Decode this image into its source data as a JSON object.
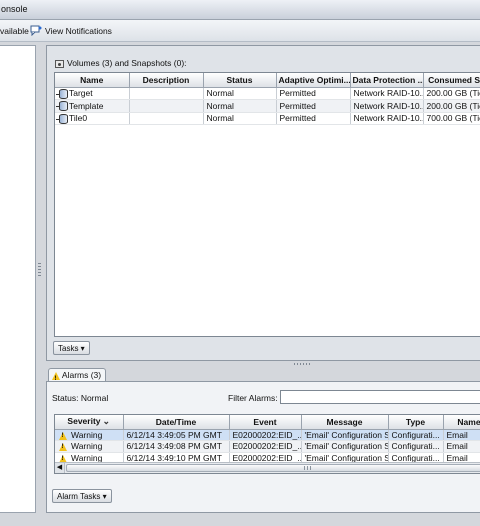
{
  "window": {
    "title": "onsole"
  },
  "toolbar": {
    "available_label": "vailable",
    "view_notifications_label": "View Notifications"
  },
  "volumes": {
    "header": "Volumes (3) and Snapshots (0):",
    "columns": [
      "Name",
      "Description",
      "Status",
      "Adaptive Optimi...",
      "Data Protection ...",
      "Consumed Spa"
    ],
    "rows": [
      {
        "name": "Target",
        "description": "",
        "status": "Normal",
        "adaptive": "Permitted",
        "protection": "Network RAID-10...",
        "consumed": "200.00 GB (Tier"
      },
      {
        "name": "Template",
        "description": "",
        "status": "Normal",
        "adaptive": "Permitted",
        "protection": "Network RAID-10...",
        "consumed": "200.00 GB (Tier"
      },
      {
        "name": "Tile0",
        "description": "",
        "status": "Normal",
        "adaptive": "Permitted",
        "protection": "Network RAID-10...",
        "consumed": "700.00 GB (Tier"
      }
    ],
    "tasks_button": "Tasks ▾"
  },
  "alarms": {
    "tab_label": "Alarms (3)",
    "status_label": "Status:  Normal",
    "filter_label": "Filter Alarms:",
    "filter_value": "",
    "columns": [
      "Severity",
      "Date/Time",
      "Event",
      "Message",
      "Type",
      "Name"
    ],
    "rows": [
      {
        "severity": "Warning",
        "datetime": "6/12/14 3:49:05 PM GMT",
        "event": "E02000202:EID_...",
        "message": "'Email' Configuration S...",
        "type": "Configurati...",
        "name": "Email"
      },
      {
        "severity": "Warning",
        "datetime": "6/12/14 3:49:08 PM GMT",
        "event": "E02000202:EID_...",
        "message": "'Email' Configuration S...",
        "type": "Configurati...",
        "name": "Email"
      },
      {
        "severity": "Warning",
        "datetime": "6/12/14 3:49:10 PM GMT",
        "event": "E02000202:EID_...",
        "message": "'Email' Configuration S...",
        "type": "Configurati...",
        "name": "Email"
      }
    ],
    "tasks_button": "Alarm Tasks ▾"
  },
  "colors": {
    "selected_row": "#cfe0f5",
    "warning": "#f2c21c"
  }
}
